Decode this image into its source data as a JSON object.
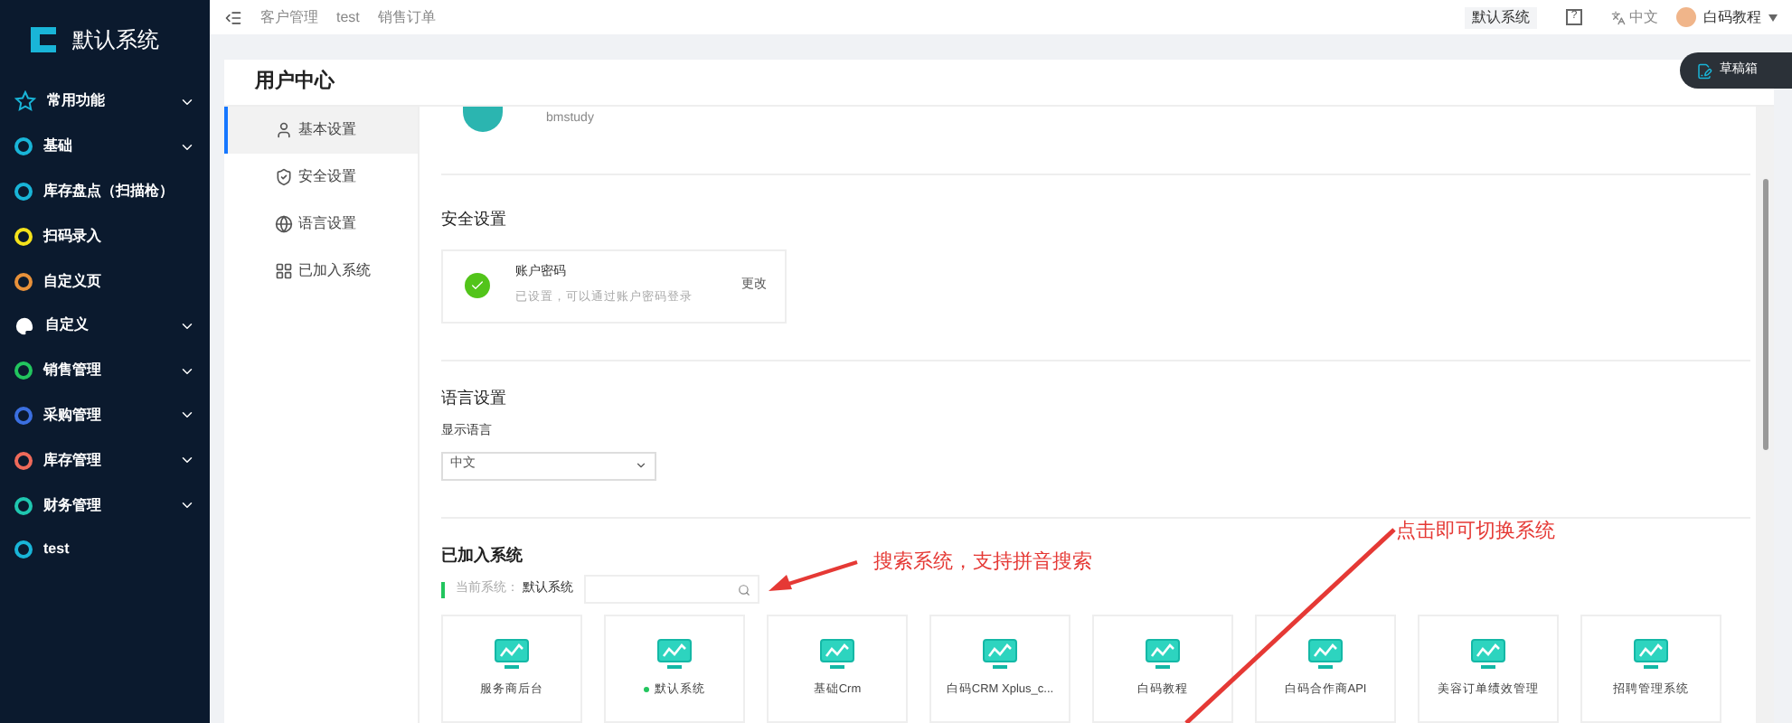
{
  "sidebar": {
    "logo_text": "默认系统",
    "items": [
      {
        "kind": "star",
        "label": "常用功能",
        "expandable": true
      },
      {
        "kind": "ring",
        "label": "基础",
        "color": "#19b5d8",
        "expandable": true
      },
      {
        "kind": "ring",
        "label": "库存盘点（扫描枪）",
        "color": "#19b5d8",
        "expandable": false
      },
      {
        "kind": "ring",
        "label": "扫码录入",
        "color": "#f5e31b",
        "expandable": false
      },
      {
        "kind": "ring",
        "label": "自定义页",
        "color": "#e8913a",
        "expandable": false
      },
      {
        "kind": "palette",
        "label": "自定义",
        "expandable": true
      },
      {
        "kind": "ring",
        "label": "销售管理",
        "color": "#22c55e",
        "expandable": true
      },
      {
        "kind": "ring",
        "label": "采购管理",
        "color": "#3b6fe0",
        "expandable": true
      },
      {
        "kind": "ring",
        "label": "库存管理",
        "color": "#ef6a5a",
        "expandable": true
      },
      {
        "kind": "ring",
        "label": "财务管理",
        "color": "#1fc7b0",
        "expandable": true
      },
      {
        "kind": "ring",
        "label": "test",
        "color": "#19b5d8",
        "expandable": false
      }
    ]
  },
  "breadcrumbs": [
    "客户管理",
    "test",
    "销售订单"
  ],
  "header": {
    "system": "默认系统",
    "help": "?",
    "language": "中文",
    "user": "白码教程"
  },
  "draft_button": "草稿箱",
  "page_title": "用户中心",
  "menu": [
    {
      "label": "基本设置",
      "selected": true
    },
    {
      "label": "安全设置",
      "selected": false
    },
    {
      "label": "语言设置",
      "selected": false
    },
    {
      "label": "已加入系统",
      "selected": false
    }
  ],
  "profile": {
    "username": "bmstudy"
  },
  "security": {
    "title": "安全设置",
    "item_title": "账户密码",
    "item_desc": "已设置，可以通过账户密码登录",
    "action": "更改"
  },
  "language": {
    "title": "语言设置",
    "label": "显示语言",
    "value": "中文"
  },
  "systems": {
    "title": "已加入系统",
    "current_label": "当前系统：",
    "current_value": "默认系统",
    "cards": [
      {
        "name": "服务商后台",
        "current": false
      },
      {
        "name": "默认系统",
        "current": true
      },
      {
        "name": "基础Crm",
        "current": false
      },
      {
        "name": "白码CRM Xplus_c...",
        "current": false
      },
      {
        "name": "白码教程",
        "current": false
      },
      {
        "name": "白码合作商API",
        "current": false
      },
      {
        "name": "美容订单绩效管理",
        "current": false
      },
      {
        "name": "招聘管理系统",
        "current": false
      }
    ]
  },
  "annotations": [
    "搜索系统，支持拼音搜索",
    "点击即可切换系统"
  ]
}
